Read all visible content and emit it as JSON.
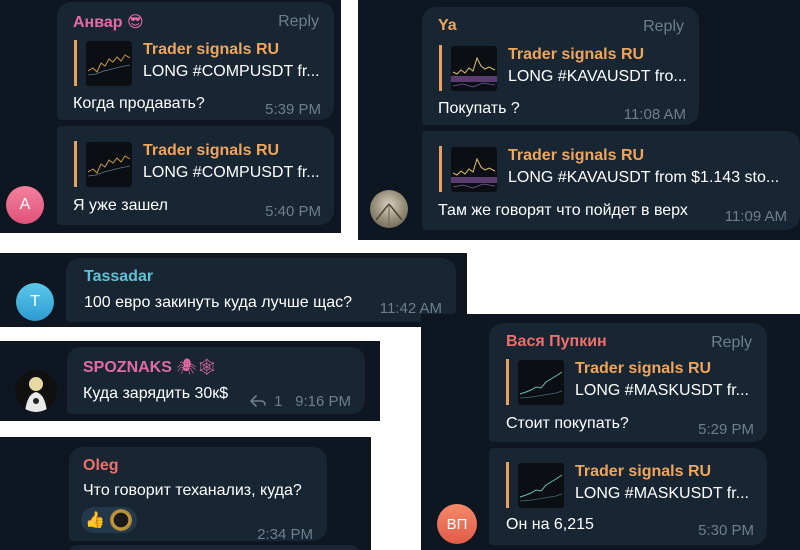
{
  "colors": {
    "background": "#0e1621",
    "bubble": "#182533",
    "quote_accent": "#f0a65a",
    "meta_gray": "#6d7f8f",
    "name_pink": "#e36ba4",
    "name_orange": "#f0a65a",
    "name_teal": "#5ec3d4",
    "name_red": "#ef6f6a"
  },
  "panel1": {
    "sender": "Анвар",
    "sender_emoji": "😎",
    "reply_label": "Reply",
    "msg1": {
      "quote_title": "Trader signals RU",
      "quote_text": "LONG #COMPUSDT fr...",
      "text": "Когда продавать?",
      "time": "5:39 PM"
    },
    "msg2": {
      "quote_title": "Trader signals RU",
      "quote_text": "LONG #COMPUSDT fr...",
      "text": "Я уже зашел",
      "time": "5:40 PM"
    },
    "avatar_letter": "А"
  },
  "panel2": {
    "sender": "Ya",
    "reply_label": "Reply",
    "msg1": {
      "quote_title": "Trader signals RU",
      "quote_text": "LONG #KAVAUSDT fro...",
      "text": "Покупать ?",
      "time": "11:08 AM"
    },
    "msg2": {
      "quote_title": "Trader signals RU",
      "quote_text": "LONG #KAVAUSDT from $1.143 sto...",
      "text": "Там же говорят что пойдет в верх",
      "time": "11:09 AM"
    }
  },
  "panel3": {
    "sender": "Tassadar",
    "text": "100 евро закинуть куда лучше щас?",
    "time": "11:42 AM",
    "avatar_letter": "T"
  },
  "panel4": {
    "sender": "SPOZNAKS",
    "sender_emoji": "🕷🕸",
    "text": "Куда зарядить 30к$",
    "reply_count": "1",
    "time": "9:16 PM"
  },
  "panel5": {
    "sender": "Oleg",
    "text": "Что говорит теханализ, куда?",
    "reaction1": "👍",
    "time": "2:34 PM"
  },
  "panel6": {
    "sender": "Вася Пупкин",
    "reply_label": "Reply",
    "msg1": {
      "quote_title": "Trader signals RU",
      "quote_text": "LONG #MASKUSDT fr...",
      "text": "Стоит покупать?",
      "time": "5:29 PM"
    },
    "msg2": {
      "quote_title": "Trader signals RU",
      "quote_text": "LONG #MASKUSDT fr...",
      "text": "Он на 6,215",
      "time": "5:30 PM"
    },
    "avatar_letters": "ВП"
  }
}
